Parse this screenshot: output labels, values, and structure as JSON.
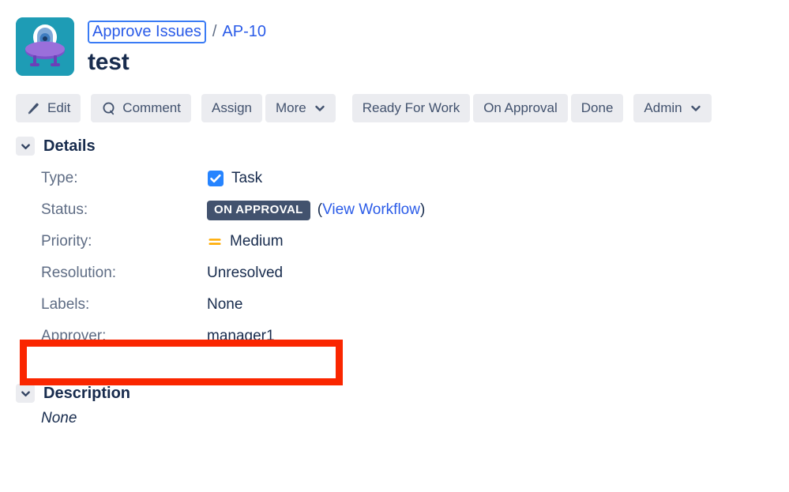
{
  "header": {
    "avatar_icon": "ufo-avatar-icon",
    "avatar_bg": "#1E9CB5",
    "breadcrumb": {
      "project_label": "Approve Issues",
      "separator": "/",
      "issue_key": "AP-10"
    },
    "issue_title": "test"
  },
  "toolbar": {
    "buttons": [
      {
        "label": "Edit",
        "icon": "pencil-icon",
        "chevron": false
      },
      {
        "label": "Comment",
        "icon": "speech-bubble-icon",
        "chevron": false
      },
      {
        "label": "Assign",
        "icon": null,
        "chevron": false
      },
      {
        "label": "More",
        "icon": null,
        "chevron": true
      },
      {
        "label": "Ready For Work",
        "icon": null,
        "chevron": false
      },
      {
        "label": "On Approval",
        "icon": null,
        "chevron": false
      },
      {
        "label": "Done",
        "icon": null,
        "chevron": false
      },
      {
        "label": "Admin",
        "icon": null,
        "chevron": true
      }
    ]
  },
  "details": {
    "section_title": "Details",
    "fields": [
      {
        "label": "Type:",
        "value": "Task",
        "icon": "task-checkbox-icon"
      },
      {
        "label": "Status:",
        "value": "ON APPROVAL",
        "icon": null,
        "badge": true,
        "badge_color": "#42526E",
        "link_prefix": "(",
        "link_text": "View Workflow",
        "link_suffix": ")"
      },
      {
        "label": "Priority:",
        "value": "Medium",
        "icon": "priority-medium-icon"
      },
      {
        "label": "Resolution:",
        "value": "Unresolved",
        "icon": null
      },
      {
        "label": "Labels:",
        "value": "None",
        "icon": null
      },
      {
        "label": "Approver:",
        "value": "manager1",
        "icon": null,
        "highlighted": true
      }
    ]
  },
  "description": {
    "section_title": "Description",
    "body": "None"
  },
  "annotation": {
    "color": "#FA2600",
    "target": "approver-field-row"
  },
  "colors": {
    "link": "#2A5BE8",
    "text": "#172B4D",
    "muted": "#5E6C84",
    "button_bg": "#EBECF0",
    "accent_blue": "#2684FF",
    "priority_orange": "#FFAB00"
  }
}
